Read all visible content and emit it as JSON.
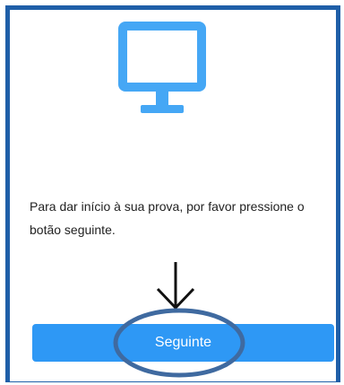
{
  "message": "Para dar início à sua prova, por favor pressione o botão seguinte.",
  "button": {
    "label": "Seguinte"
  },
  "icons": {
    "monitor": "monitor-icon",
    "arrow": "arrow-down-icon",
    "highlight": "highlight-ellipse"
  },
  "colors": {
    "accent": "#2e98f5",
    "frame": "#1f5fa8",
    "highlight": "#3f6aa0",
    "text": "#222222"
  }
}
